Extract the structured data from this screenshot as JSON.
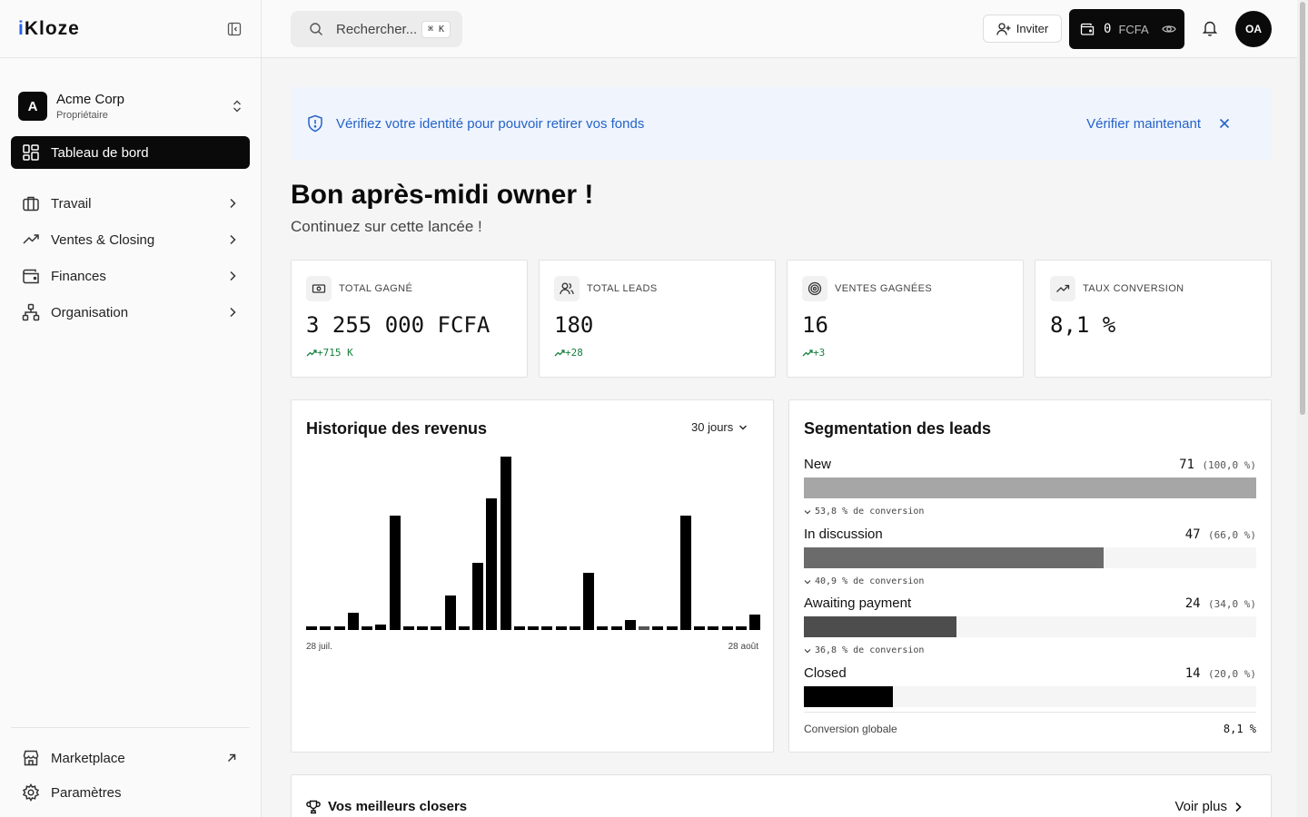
{
  "app": {
    "logo_prefix": "i",
    "logo_rest": "Kloze"
  },
  "org": {
    "initial": "A",
    "name": "Acme Corp",
    "role": "Propriétaire"
  },
  "nav": {
    "active": "Tableau de bord",
    "items": [
      {
        "label": "Travail",
        "icon": "briefcase-icon"
      },
      {
        "label": "Ventes & Closing",
        "icon": "trending-up-icon"
      },
      {
        "label": "Finances",
        "icon": "wallet-icon"
      },
      {
        "label": "Organisation",
        "icon": "org-chart-icon"
      }
    ],
    "bottom": [
      {
        "label": "Marketplace",
        "icon": "store-icon"
      },
      {
        "label": "Paramètres",
        "icon": "gear-icon"
      }
    ]
  },
  "topbar": {
    "search_placeholder": "Rechercher...",
    "search_shortcut": "⌘ K",
    "invite_label": "Inviter",
    "wallet_amount": "0",
    "wallet_currency": "FCFA",
    "avatar_initials": "OA"
  },
  "alert": {
    "message": "Vérifiez votre identité pour pouvoir retirer vos fonds",
    "cta": "Vérifier maintenant"
  },
  "greeting": {
    "title": "Bon après-midi owner !",
    "subtitle": "Continuez sur cette lancée !"
  },
  "kpis": [
    {
      "label": "TOTAL GAGNÉ",
      "value": "3 255 000 FCFA",
      "delta": "+715 K",
      "icon": "cash-icon"
    },
    {
      "label": "TOTAL LEADS",
      "value": "180",
      "delta": "+28",
      "icon": "users-icon"
    },
    {
      "label": "VENTES GAGNÉES",
      "value": "16",
      "delta": "+3",
      "icon": "target-icon"
    },
    {
      "label": "TAUX CONVERSION",
      "value": "8,1 %",
      "delta": "",
      "icon": "trending-up-icon"
    }
  ],
  "revenue": {
    "title": "Historique des revenus",
    "period": "30 jours",
    "x_start": "28 juil.",
    "x_end": "28 août"
  },
  "chart_data": {
    "type": "bar",
    "title": "Historique des revenus",
    "xlabel": "",
    "ylabel": "",
    "x_range": [
      "28 juil.",
      "28 août"
    ],
    "values": [
      2,
      2,
      2,
      10,
      2,
      3,
      66,
      2,
      2,
      2,
      20,
      2,
      39,
      76,
      100,
      2,
      2,
      2,
      2,
      2,
      33,
      2,
      2,
      6,
      2,
      2,
      2,
      66,
      2,
      2,
      2,
      2,
      9
    ],
    "highlight_index": 24,
    "grid": false,
    "legend": "none"
  },
  "segmentation": {
    "title": "Segmentation des leads",
    "stages": [
      {
        "name": "New",
        "count": "71",
        "pct": "(100,0 %)",
        "share": 1.0,
        "color": "#a6a6a6",
        "conversion": "53,8 % de conversion"
      },
      {
        "name": "In discussion",
        "count": "47",
        "pct": "(66,0 %)",
        "share": 0.662,
        "color": "#6b6b6b",
        "conversion": "40,9 % de conversion"
      },
      {
        "name": "Awaiting payment",
        "count": "24",
        "pct": "(34,0 %)",
        "share": 0.338,
        "color": "#4d4d4d",
        "conversion": "36,8 % de conversion"
      },
      {
        "name": "Closed",
        "count": "14",
        "pct": "(20,0 %)",
        "share": 0.197,
        "color": "#000000",
        "conversion": ""
      }
    ],
    "global_label": "Conversion globale",
    "global_value": "8,1 %"
  },
  "closers": {
    "title": "Vos meilleurs closers",
    "more": "Voir plus"
  }
}
